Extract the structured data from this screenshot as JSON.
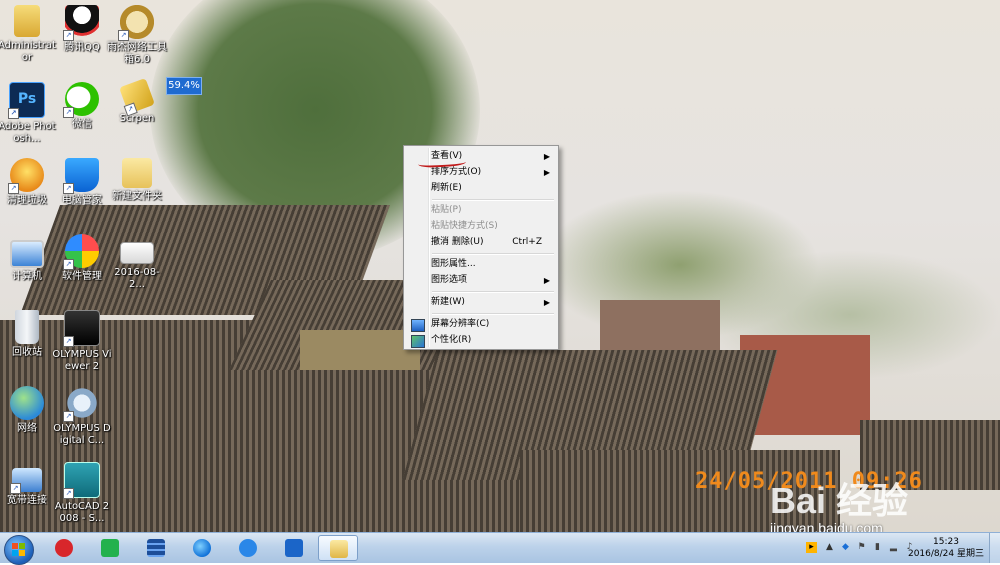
{
  "desktop": {
    "icons": [
      {
        "label": "Administrator"
      },
      {
        "label": "腾讯QQ"
      },
      {
        "label": "雨杰网络工具箱6.0"
      },
      {
        "label": "Adobe Photosh..."
      },
      {
        "label": "微信"
      },
      {
        "label": "Scrpen"
      },
      {
        "label": "清理垃圾"
      },
      {
        "label": "电脑管家"
      },
      {
        "label": "新建文件夹"
      },
      {
        "label": "计算机"
      },
      {
        "label": "软件管理"
      },
      {
        "label": "2016-08-2..."
      },
      {
        "label": "回收站"
      },
      {
        "label": "OLYMPUS Viewer 2"
      },
      {
        "label": "网络"
      },
      {
        "label": "OLYMPUS Digital C..."
      },
      {
        "label": "宽带连接"
      },
      {
        "label": "AutoCAD 2008 - S..."
      }
    ],
    "badge": "59.4%",
    "photo_stamp": "24/05/2011 09:26",
    "watermark_logo": "Bai 经验",
    "watermark_url": "jingyan.baidu.com"
  },
  "context_menu": {
    "items": [
      {
        "label": "查看(V)",
        "shortcut": "",
        "submenu": true,
        "disabled": false
      },
      {
        "label": "排序方式(O)",
        "shortcut": "",
        "submenu": true,
        "disabled": false
      },
      {
        "label": "刷新(E)",
        "shortcut": "",
        "submenu": false,
        "disabled": false
      },
      {
        "label": "粘贴(P)",
        "shortcut": "",
        "submenu": false,
        "disabled": true
      },
      {
        "label": "粘贴快捷方式(S)",
        "shortcut": "",
        "submenu": false,
        "disabled": true
      },
      {
        "label": "撤消 删除(U)",
        "shortcut": "Ctrl+Z",
        "submenu": false,
        "disabled": false
      },
      {
        "label": "图形属性...",
        "shortcut": "",
        "submenu": false,
        "disabled": false
      },
      {
        "label": "图形选项",
        "shortcut": "",
        "submenu": true,
        "disabled": false
      },
      {
        "label": "新建(W)",
        "shortcut": "",
        "submenu": true,
        "disabled": false
      },
      {
        "label": "屏幕分辨率(C)",
        "shortcut": "",
        "submenu": false,
        "disabled": false
      },
      {
        "label": "个性化(R)",
        "shortcut": "",
        "submenu": false,
        "disabled": false
      }
    ]
  },
  "taskbar": {
    "clock_time": "15:23",
    "clock_date": "2016/8/24 星期三",
    "pinned": [
      "netease-music",
      "green-app",
      "media-player",
      "browser",
      "cloud-sync",
      "maxthon",
      "file-explorer"
    ]
  },
  "colors": {
    "menu_bg": "#f0f0f0",
    "taskbar_top": "#dbe7f3",
    "stamp": "#f08a1c",
    "annotation_red": "#c01a1a"
  }
}
